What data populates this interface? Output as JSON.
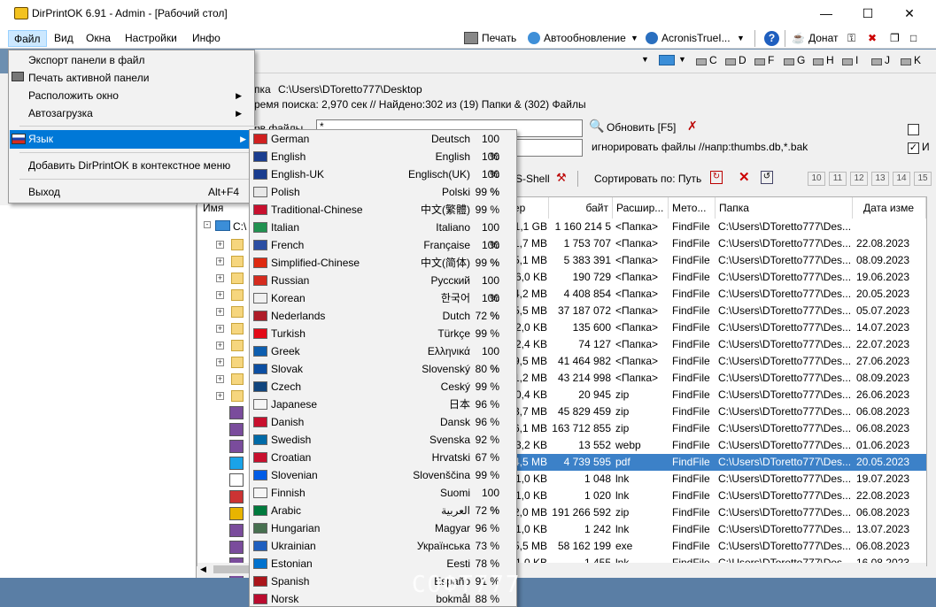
{
  "window": {
    "title": "DirPrintOK 6.91 - Admin - [Рабочий стол]"
  },
  "menubar": {
    "items": [
      "Файл",
      "Вид",
      "Окна",
      "Настройки",
      "Инфо"
    ]
  },
  "toolbar": {
    "print": "Печать",
    "autoupdate": "Автообновление",
    "acronis": "AcronisTrueI...",
    "donate": "Донат"
  },
  "drives": [
    "C",
    "D",
    "F",
    "G",
    "H",
    "I",
    "J",
    "K"
  ],
  "info": {
    "path_label": "пка",
    "path": "C:\\Users\\DToretto777\\Desktop",
    "search_line": "ремя поиска: 2,970 сек //  Найдено:302 из (19) Папки & (302) Файлы",
    "filter_label": "ов файлы",
    "filter_value": "*",
    "refresh": "Обновить [F5]",
    "ignore_text": "игнорировать файлы //напр:thumbs.db,*.bak",
    "right_label": "И"
  },
  "tbar3": {
    "shell": "S-Shell",
    "sort": "Сортировать по: Путь",
    "nums": [
      "10",
      "11",
      "12",
      "13",
      "14",
      "15"
    ]
  },
  "grid": {
    "headers": {
      "name": "Имя",
      "size": "Размер",
      "bytes": "байт",
      "ext": "Расшир...",
      "method": "Мето...",
      "folder": "Папка",
      "date": "Дата изме"
    },
    "root": "C:\\",
    "rows": [
      {
        "size": "1,1 GB",
        "bytes": "1 160 214 5",
        "ext": "<Папка>",
        "method": "FindFile",
        "folder": "C:\\Users\\DToretto777\\Des...",
        "date": ""
      },
      {
        "size": "1,7 MB",
        "bytes": "1 753 707",
        "ext": "<Папка>",
        "method": "FindFile",
        "folder": "C:\\Users\\DToretto777\\Des...",
        "date": "22.08.2023"
      },
      {
        "size": "5,1 MB",
        "bytes": "5 383 391",
        "ext": "<Папка>",
        "method": "FindFile",
        "folder": "C:\\Users\\DToretto777\\Des...",
        "date": "08.09.2023"
      },
      {
        "size": "6,0 KB",
        "bytes": "190 729",
        "ext": "<Папка>",
        "method": "FindFile",
        "folder": "C:\\Users\\DToretto777\\Des...",
        "date": "19.06.2023"
      },
      {
        "size": "4,2 MB",
        "bytes": "4 408 854",
        "ext": "<Папка>",
        "method": "FindFile",
        "folder": "C:\\Users\\DToretto777\\Des...",
        "date": "20.05.2023"
      },
      {
        "size": "5,5 MB",
        "bytes": "37 187 072",
        "ext": "<Папка>",
        "method": "FindFile",
        "folder": "C:\\Users\\DToretto777\\Des...",
        "date": "05.07.2023"
      },
      {
        "size": "2,0 KB",
        "bytes": "135 600",
        "ext": "<Папка>",
        "method": "FindFile",
        "folder": "C:\\Users\\DToretto777\\Des...",
        "date": "14.07.2023"
      },
      {
        "size": "2,4 KB",
        "bytes": "74 127",
        "ext": "<Папка>",
        "method": "FindFile",
        "folder": "C:\\Users\\DToretto777\\Des...",
        "date": "22.07.2023"
      },
      {
        "size": "9,5 MB",
        "bytes": "41 464 982",
        "ext": "<Папка>",
        "method": "FindFile",
        "folder": "C:\\Users\\DToretto777\\Des...",
        "date": "27.06.2023"
      },
      {
        "size": "1,2 MB",
        "bytes": "43 214 998",
        "ext": "<Папка>",
        "method": "FindFile",
        "folder": "C:\\Users\\DToretto777\\Des...",
        "date": "08.09.2023"
      },
      {
        "size": "0,4 KB",
        "bytes": "20 945",
        "ext": "zip",
        "method": "FindFile",
        "folder": "C:\\Users\\DToretto777\\Des...",
        "date": "26.06.2023"
      },
      {
        "size": "3,7 MB",
        "bytes": "45 829 459",
        "ext": "zip",
        "method": "FindFile",
        "folder": "C:\\Users\\DToretto777\\Des...",
        "date": "06.08.2023"
      },
      {
        "size": "6,1 MB",
        "bytes": "163 712 855",
        "ext": "zip",
        "method": "FindFile",
        "folder": "C:\\Users\\DToretto777\\Des...",
        "date": "06.08.2023"
      },
      {
        "size": "3,2 KB",
        "bytes": "13 552",
        "ext": "webp",
        "method": "FindFile",
        "folder": "C:\\Users\\DToretto777\\Des...",
        "date": "01.06.2023"
      },
      {
        "size": "4,5 MB",
        "bytes": "4 739 595",
        "ext": "pdf",
        "method": "FindFile",
        "folder": "C:\\Users\\DToretto777\\Des...",
        "date": "20.05.2023"
      },
      {
        "size": "1,0 KB",
        "bytes": "1 048",
        "ext": "lnk",
        "method": "FindFile",
        "folder": "C:\\Users\\DToretto777\\Des...",
        "date": "19.07.2023"
      },
      {
        "size": "1,0 KB",
        "bytes": "1 020",
        "ext": "lnk",
        "method": "FindFile",
        "folder": "C:\\Users\\DToretto777\\Des...",
        "date": "22.08.2023"
      },
      {
        "size": "2,0 MB",
        "bytes": "191 266 592",
        "ext": "zip",
        "method": "FindFile",
        "folder": "C:\\Users\\DToretto777\\Des...",
        "date": "06.08.2023"
      },
      {
        "size": "1,0 KB",
        "bytes": "1 242",
        "ext": "lnk",
        "method": "FindFile",
        "folder": "C:\\Users\\DToretto777\\Des...",
        "date": "13.07.2023"
      },
      {
        "size": "5,5 MB",
        "bytes": "58 162 199",
        "ext": "exe",
        "method": "FindFile",
        "folder": "C:\\Users\\DToretto777\\Des...",
        "date": "06.08.2023"
      },
      {
        "size": "1,0 KB",
        "bytes": "1 455",
        "ext": "lnk",
        "method": "FindFile",
        "folder": "C:\\Users\\DToretto777\\Des...",
        "date": "16.08.2023"
      }
    ]
  },
  "file_menu": {
    "export": "Экспорт панели в файл",
    "print_panel": "Печать активной панели",
    "arrange": "Расположить окно",
    "autoload": "Автозагрузка",
    "language": "Язык",
    "context": "Добавить DirPrintOK в контекстное меню",
    "exit": "Выход",
    "exit_shortcut": "Alt+F4"
  },
  "languages": [
    {
      "name": "German",
      "native": "Deutsch",
      "pct": "100 %"
    },
    {
      "name": "English",
      "native": "English",
      "pct": "100 %"
    },
    {
      "name": "English-UK",
      "native": "Englisch(UK)",
      "pct": "100 %"
    },
    {
      "name": "Polish",
      "native": "Polski",
      "pct": "99 %"
    },
    {
      "name": "Traditional-Chinese",
      "native": "中文(繁體)",
      "pct": "99 %"
    },
    {
      "name": "Italian",
      "native": "Italiano",
      "pct": "100 %"
    },
    {
      "name": "French",
      "native": "Française",
      "pct": "100 %"
    },
    {
      "name": "Simplified-Chinese",
      "native": "中文(简体)",
      "pct": "99 %"
    },
    {
      "name": "Russian",
      "native": "Русский",
      "pct": "100 %"
    },
    {
      "name": "Korean",
      "native": "한국어",
      "pct": "100 %"
    },
    {
      "name": "Nederlands",
      "native": "Dutch",
      "pct": "72 %"
    },
    {
      "name": "Turkish",
      "native": "Türkçe",
      "pct": "99 %"
    },
    {
      "name": "Greek",
      "native": "Ελληνικά",
      "pct": "100 %"
    },
    {
      "name": "Slovak",
      "native": "Slovenský",
      "pct": "80 %"
    },
    {
      "name": "Czech",
      "native": "Ceský",
      "pct": "99 %"
    },
    {
      "name": "Japanese",
      "native": "日本",
      "pct": "96 %"
    },
    {
      "name": "Danish",
      "native": "Dansk",
      "pct": "96 %"
    },
    {
      "name": "Swedish",
      "native": "Svenska",
      "pct": "92 %"
    },
    {
      "name": "Croatian",
      "native": "Hrvatski",
      "pct": "67 %"
    },
    {
      "name": "Slovenian",
      "native": "Slovenščina",
      "pct": "99 %"
    },
    {
      "name": "Finnish",
      "native": "Suomi",
      "pct": "100 %"
    },
    {
      "name": "Arabic",
      "native": "العربية",
      "pct": "72 %"
    },
    {
      "name": "Hungarian",
      "native": "Magyar",
      "pct": "96 %"
    },
    {
      "name": "Ukrainian",
      "native": "Українська",
      "pct": "73 %"
    },
    {
      "name": "Estonian",
      "native": "Eesti",
      "pct": "78 %"
    },
    {
      "name": "Spanish",
      "native": "Españo",
      "pct": "91 %"
    },
    {
      "name": "Norsk",
      "native": "bokmål",
      "pct": "88 %"
    }
  ],
  "flag_colors": [
    "#d02020",
    "#1a3d8f",
    "#1a3d8f",
    "#e8e8e8",
    "#c8102e",
    "#219150",
    "#2b4ea2",
    "#de2910",
    "#d52b1e",
    "#f0f0f0",
    "#ae1c28",
    "#e30a17",
    "#0d5eaf",
    "#0b4ea2",
    "#11457e",
    "#f5f5f5",
    "#c8102e",
    "#006aa7",
    "#c8102e",
    "#005ce6",
    "#f5f5f5",
    "#007a3d",
    "#477050",
    "#1f5fbf",
    "#0072ce",
    "#aa151b",
    "#ba0c2f"
  ],
  "watermark": "СОФТ777"
}
